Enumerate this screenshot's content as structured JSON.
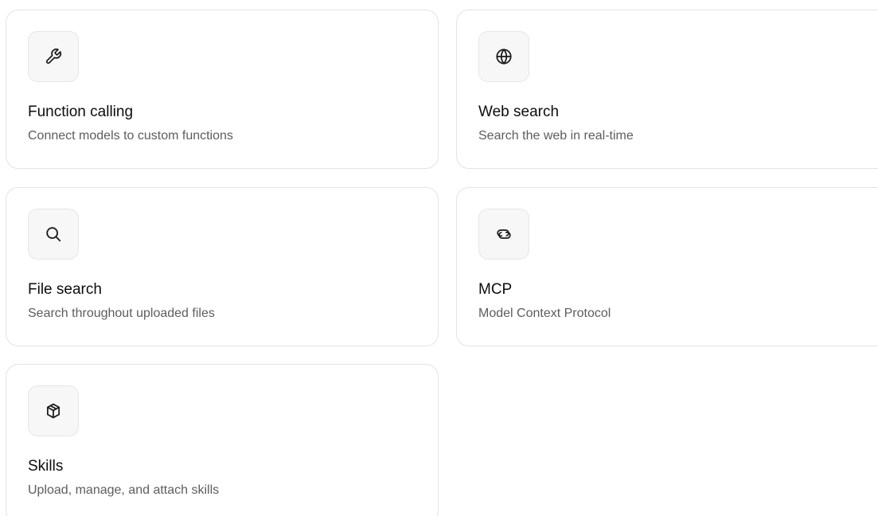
{
  "tools": [
    {
      "title": "Function calling",
      "subtitle": "Connect models to custom functions",
      "icon": "wrench-icon"
    },
    {
      "title": "Web search",
      "subtitle": "Search the web in real-time",
      "icon": "globe-icon"
    },
    {
      "title": "File search",
      "subtitle": "Search throughout uploaded files",
      "icon": "search-icon"
    },
    {
      "title": "MCP",
      "subtitle": "Model Context Protocol",
      "icon": "link-icon"
    },
    {
      "title": "Skills",
      "subtitle": "Upload, manage, and attach skills",
      "icon": "cube-icon"
    }
  ],
  "colors": {
    "card_border": "#e3e3e3",
    "icon_background": "#f7f7f7",
    "title_text": "#0d0d0d",
    "subtitle_text": "#5d5d5d"
  }
}
